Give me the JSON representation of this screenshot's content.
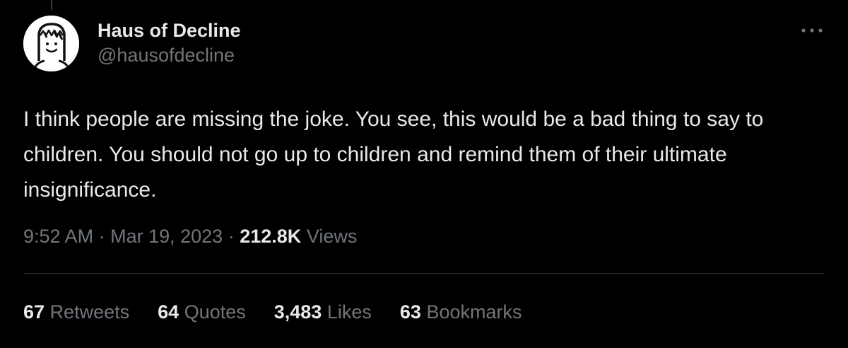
{
  "author": {
    "display_name": "Haus of Decline",
    "handle": "@hausofdecline",
    "avatar_icon": "cartoon-face-avatar"
  },
  "more_icon": "more-horizontal-icon",
  "tweet": {
    "text": "I think people are missing the joke. You see, this would be a bad thing to say to children. You should not go up to children and remind them of their ultimate insignificance."
  },
  "meta": {
    "time": "9:52 AM",
    "separator": "·",
    "date": "Mar 19, 2023",
    "views_count": "212.8K",
    "views_label": "Views"
  },
  "stats": {
    "retweets": {
      "count": "67",
      "label": "Retweets"
    },
    "quotes": {
      "count": "64",
      "label": "Quotes"
    },
    "likes": {
      "count": "3,483",
      "label": "Likes"
    },
    "bookmarks": {
      "count": "63",
      "label": "Bookmarks"
    }
  },
  "colors": {
    "background": "#000000",
    "primary_text": "#e7e9ea",
    "secondary_text": "#71767b",
    "divider": "#2f3336"
  }
}
